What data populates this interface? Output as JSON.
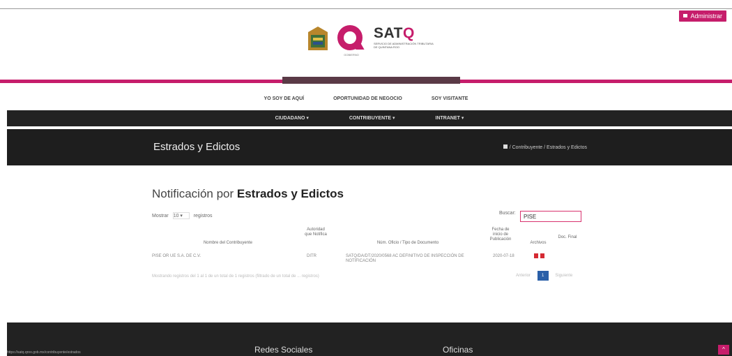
{
  "header": {
    "admin_label": "Administrar",
    "sat_word_left": "SAT",
    "sat_word_right": "Q",
    "sat_subtitle": "SERVICIO DE ADMINISTRACIÓN TRIBUTARIA DE QUINTANA ROO",
    "q_caption": "GOBIERNO"
  },
  "topnav": [
    "YO SOY DE AQUÍ",
    "OPORTUNIDAD DE NEGOCIO",
    "SOY VISITANTE"
  ],
  "mainnav": [
    "CIUDADANO ▾",
    "CONTRIBUYENTE ▾",
    "INTRANET ▾"
  ],
  "banner": {
    "title": "Estrados y Edictos",
    "breadcrumb": "/ Contribuyente / Estrados y Edictos"
  },
  "content": {
    "heading_light": "Notificación por ",
    "heading_bold": "Estrados y Edictos",
    "show_label": "Mostrar",
    "show_value": "10",
    "show_suffix": "registros",
    "search_label": "Buscar:",
    "search_value": "PISE",
    "columns": [
      "Nombre del Contribuyente",
      "Autoridad que Notifica",
      "Núm. Oficio / Tipo de Documento",
      "Fecha de inicio de Publicación",
      "Archivos",
      "Doc. Final"
    ],
    "rows": [
      {
        "name": "PISE OR UE S.A. DE C.V.",
        "authority": "DITR",
        "document": "SATQ/DA/DT/2020/0568 AC DEFINITIVO DE INSPECCIÓN DE NOTIFICACIÓN",
        "date": "2020-07-18"
      }
    ],
    "info_text": "Mostrando registros del 1 al 1 de un total de 1 registros (filtrado de un total de ... registros)",
    "pager_prev": "Anterior",
    "pager_current": "1",
    "pager_next": "Siguiente"
  },
  "footer": {
    "left_title": "Redes Sociales",
    "right_title": "Oficinas",
    "status_url": "https://satq.qroo.gob.mx/contribuyente/estrados",
    "to_top": "^"
  }
}
